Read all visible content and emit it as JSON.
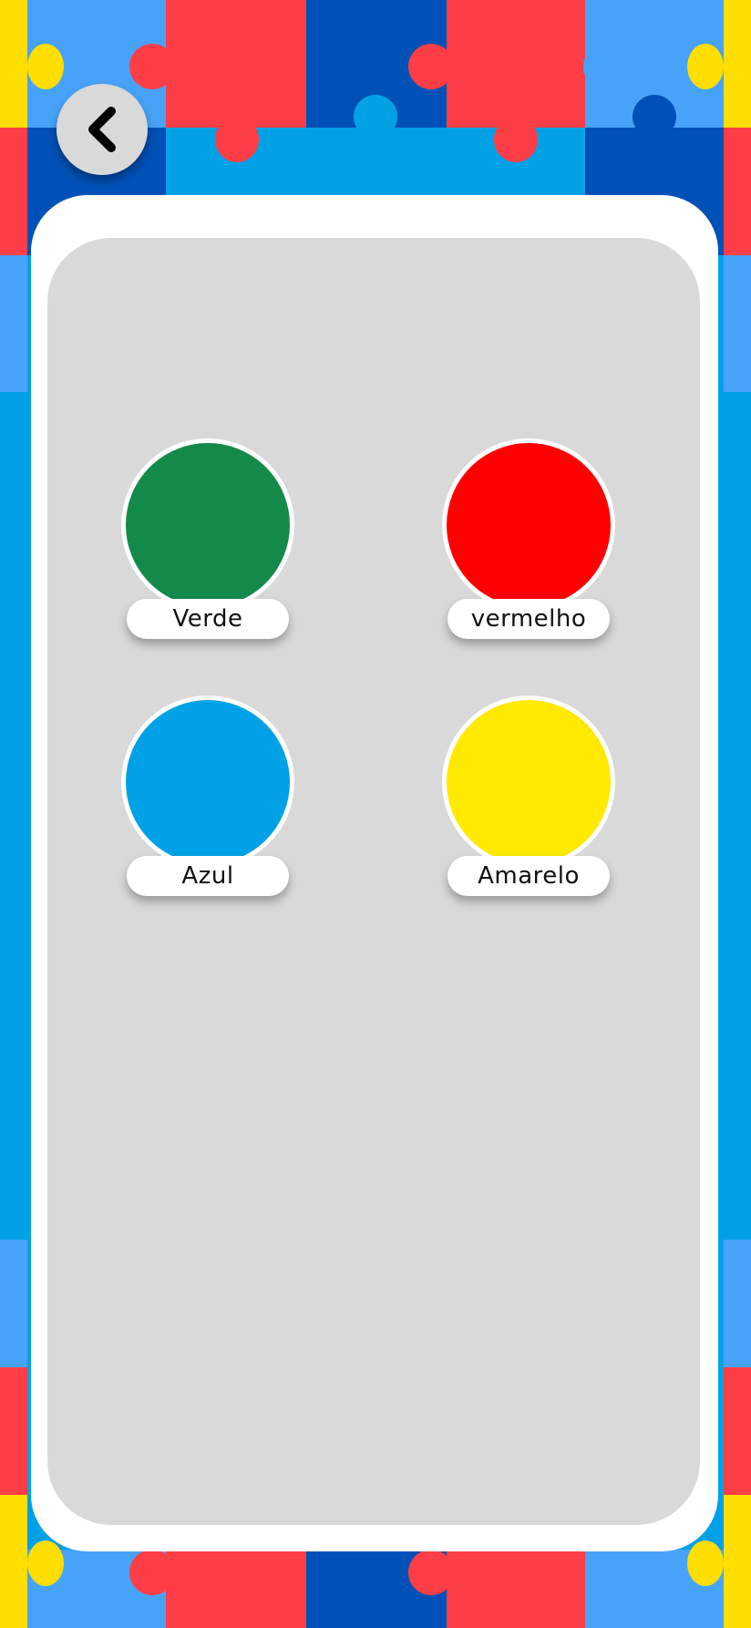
{
  "screen": {
    "back_icon": "chevron-left-icon",
    "colors": [
      {
        "label": "Verde",
        "hex": "#138a4a"
      },
      {
        "label": "vermelho",
        "hex": "#ff0000"
      },
      {
        "label": "Azul",
        "hex": "#00a1e6"
      },
      {
        "label": "Amarelo",
        "hex": "#ffea00"
      }
    ]
  },
  "palette": {
    "puzzle_red": "#fe3e47",
    "puzzle_dark_blue": "#0051b7",
    "puzzle_light_blue": "#47a3f8",
    "puzzle_cyan": "#02a1e6",
    "puzzle_yellow": "#ffde00",
    "panel_gray": "#d9d9d9"
  }
}
